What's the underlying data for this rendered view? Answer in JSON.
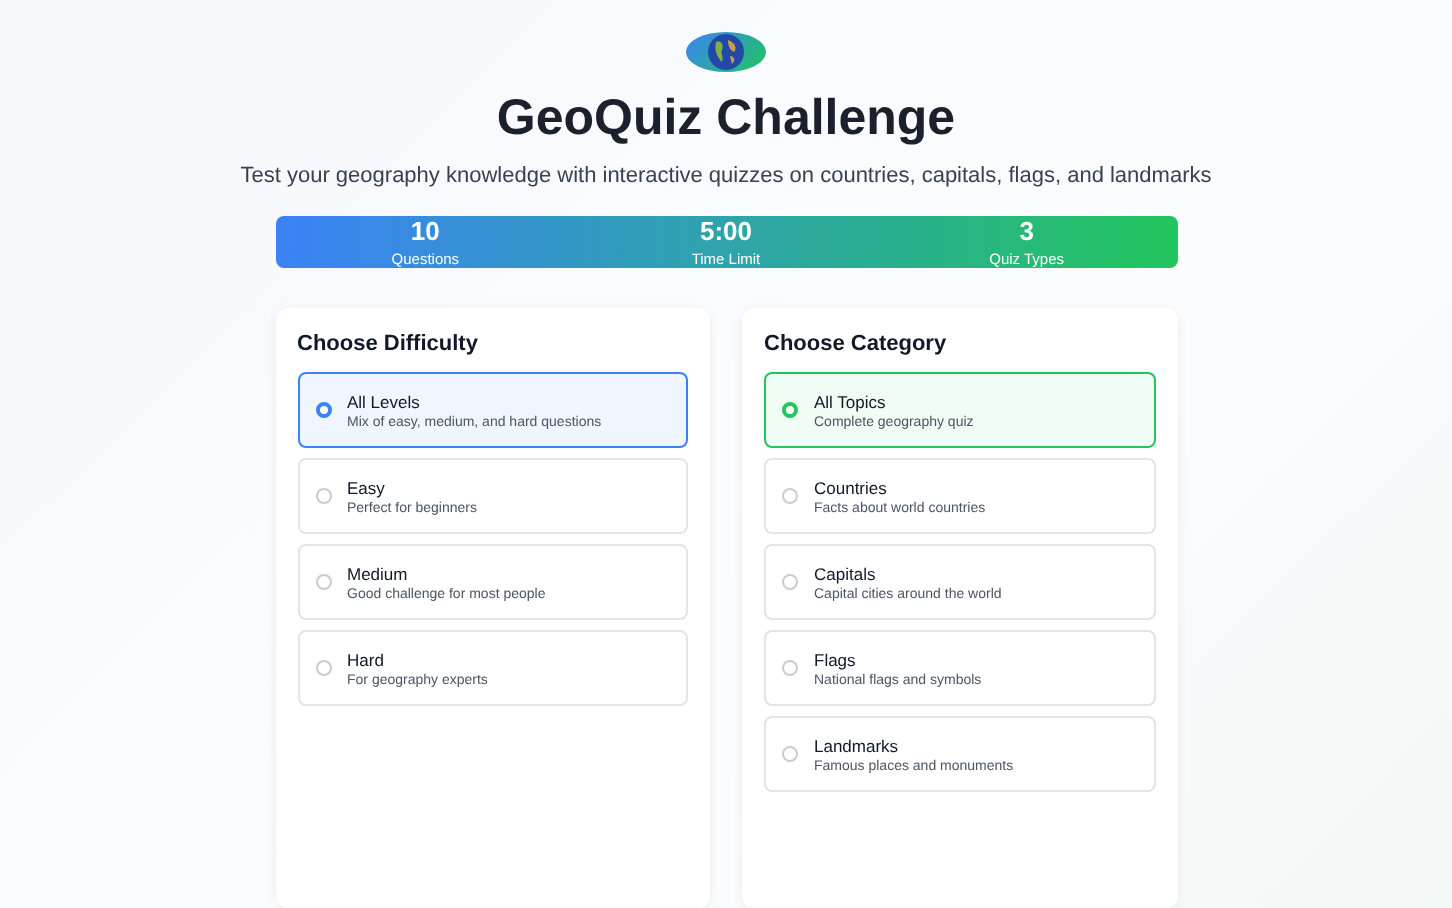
{
  "header": {
    "title": "GeoQuiz Challenge",
    "subtitle": "Test your geography knowledge with interactive quizzes on countries, capitals, flags, and landmarks"
  },
  "stats": [
    {
      "value": "10",
      "label": "Questions"
    },
    {
      "value": "5:00",
      "label": "Time Limit"
    },
    {
      "value": "3",
      "label": "Quiz Types"
    }
  ],
  "panels": [
    {
      "kind": "difficulty",
      "title": "Choose Difficulty",
      "options": [
        {
          "label": "All Levels",
          "description": "Mix of easy, medium, and hard questions",
          "selected": true
        },
        {
          "label": "Easy",
          "description": "Perfect for beginners",
          "selected": false
        },
        {
          "label": "Medium",
          "description": "Good challenge for most people",
          "selected": false
        },
        {
          "label": "Hard",
          "description": "For geography experts",
          "selected": false
        }
      ]
    },
    {
      "kind": "category",
      "title": "Choose Category",
      "options": [
        {
          "label": "All Topics",
          "description": "Complete geography quiz",
          "selected": true
        },
        {
          "label": "Countries",
          "description": "Facts about world countries",
          "selected": false
        },
        {
          "label": "Capitals",
          "description": "Capital cities around the world",
          "selected": false
        },
        {
          "label": "Flags",
          "description": "National flags and symbols",
          "selected": false
        },
        {
          "label": "Landmarks",
          "description": "Famous places and monuments",
          "selected": false
        }
      ]
    }
  ]
}
